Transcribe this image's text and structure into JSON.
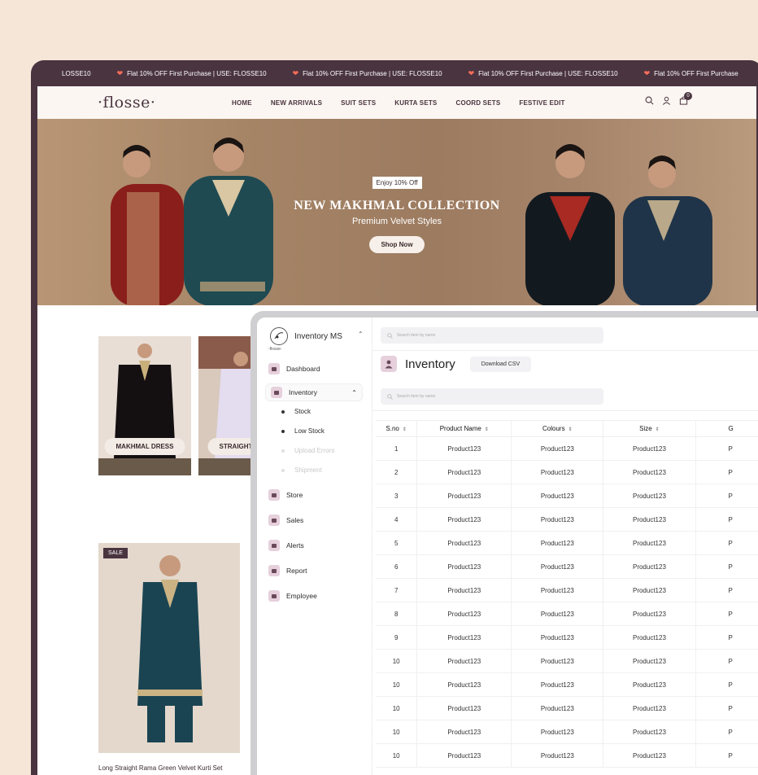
{
  "promo": {
    "first": "LOSSE10",
    "items": [
      "Flat 10% OFF First Purchase | USE: FLOSSE10",
      "Flat 10% OFF First Purchase | USE: FLOSSE10",
      "Flat 10% OFF First Purchase | USE: FLOSSE10",
      "Flat 10% OFF First Purchase"
    ]
  },
  "site": {
    "logo": "·flosse·",
    "menu": [
      "HOME",
      "NEW ARRIVALS",
      "SUIT SETS",
      "KURTA SETS",
      "COORD SETS",
      "FESTIVE EDIT"
    ],
    "cart_count": "0"
  },
  "hero": {
    "badge": "Enjoy 10% Off",
    "title": "NEW MAKHMAL COLLECTION",
    "subtitle": "Premium Velvet Styles",
    "cta": "Shop Now"
  },
  "cards": {
    "first_label": "MAKHMAL DRESS",
    "second_label": "STRAIGHT",
    "sale_badge": "SALE",
    "product_title": "Long Straight Rama Green Velvet Kurti Set"
  },
  "dashboard": {
    "brand": "Inventory MS",
    "brand_sub": "-flosse-",
    "search_placeholder": "Search item by name",
    "nav": {
      "dashboard": "Dashboard",
      "inventory": "Inventory",
      "stock": "Stock",
      "low_stock": "Low Stock",
      "upload_errors": "Upload Errors",
      "shipment": "Shipment",
      "store": "Store",
      "sales": "Sales",
      "alerts": "Alerts",
      "report": "Report",
      "employee": "Employee"
    },
    "page_title": "Inventory",
    "download": "Download CSV",
    "table": {
      "headers": [
        "S.no",
        "Product Name",
        "Colours",
        "Size",
        "G"
      ],
      "rows": [
        [
          "1",
          "Product123",
          "Product123",
          "Product123",
          "P"
        ],
        [
          "2",
          "Product123",
          "Product123",
          "Product123",
          "P"
        ],
        [
          "3",
          "Product123",
          "Product123",
          "Product123",
          "P"
        ],
        [
          "4",
          "Product123",
          "Product123",
          "Product123",
          "P"
        ],
        [
          "5",
          "Product123",
          "Product123",
          "Product123",
          "P"
        ],
        [
          "6",
          "Product123",
          "Product123",
          "Product123",
          "P"
        ],
        [
          "7",
          "Product123",
          "Product123",
          "Product123",
          "P"
        ],
        [
          "8",
          "Product123",
          "Product123",
          "Product123",
          "P"
        ],
        [
          "9",
          "Product123",
          "Product123",
          "Product123",
          "P"
        ],
        [
          "10",
          "Product123",
          "Product123",
          "Product123",
          "P"
        ],
        [
          "10",
          "Product123",
          "Product123",
          "Product123",
          "P"
        ],
        [
          "10",
          "Product123",
          "Product123",
          "Product123",
          "P"
        ],
        [
          "10",
          "Product123",
          "Product123",
          "Product123",
          "P"
        ],
        [
          "10",
          "Product123",
          "Product123",
          "Product123",
          "P"
        ]
      ]
    }
  }
}
